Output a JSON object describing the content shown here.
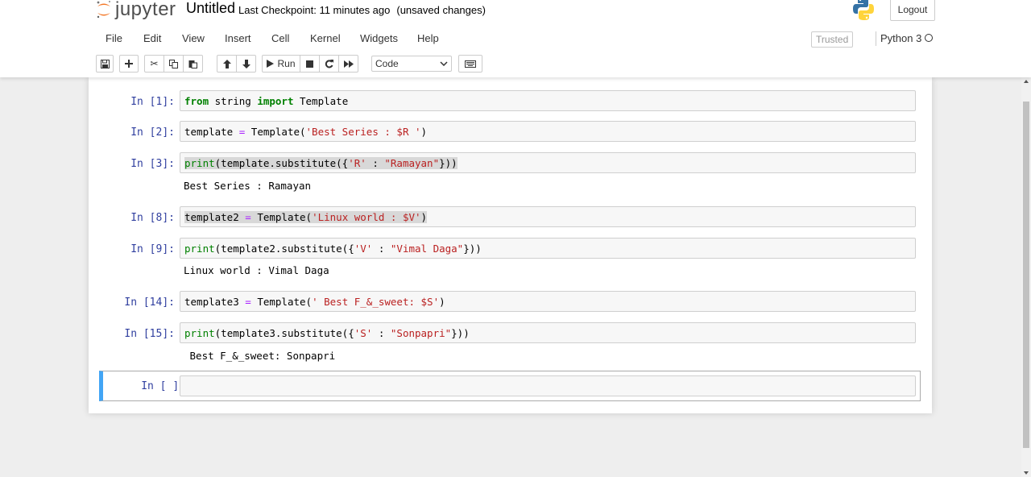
{
  "header": {
    "logo_text": "jupyter",
    "notebook_title": "Untitled",
    "checkpoint": "Last Checkpoint: 11 minutes ago",
    "unsaved": "(unsaved changes)",
    "logout_label": "Logout"
  },
  "menu": {
    "items": [
      "File",
      "Edit",
      "View",
      "Insert",
      "Cell",
      "Kernel",
      "Widgets",
      "Help"
    ],
    "trusted": "Trusted",
    "kernel_name": "Python 3"
  },
  "toolbar": {
    "run_label": "Run",
    "cell_type": "Code"
  },
  "cells": [
    {
      "prompt": "In [1]:",
      "output": ""
    },
    {
      "prompt": "In [2]:",
      "output": ""
    },
    {
      "prompt": "In [3]:",
      "output": "Best Series : Ramayan"
    },
    {
      "prompt": "In [8]:",
      "output": ""
    },
    {
      "prompt": "In [9]:",
      "output": "Linux world : Vimal Daga"
    },
    {
      "prompt": "In [14]:",
      "output": ""
    },
    {
      "prompt": "In [15]:",
      "output": " Best F_&_sweet: Sonpapri"
    },
    {
      "prompt": "In [ ]:",
      "output": ""
    }
  ],
  "code": {
    "c1": {
      "kw1": "from",
      "t1": " string ",
      "kw2": "import",
      "t2": " Template"
    },
    "c2": {
      "t1": "template ",
      "op": "=",
      "t2": " Template(",
      "s": "'Best Series : $R '",
      "t3": ")"
    },
    "c3": {
      "fn": "print",
      "t1": "(template.substitute({",
      "s1": "'R'",
      "t2": " : ",
      "s2": "\"Ramayan\"",
      "t3": "}))"
    },
    "c8": {
      "t1": "template2 ",
      "op": "=",
      "t2": " Template(",
      "s": "'Linux world : $V'",
      "t3": ")"
    },
    "c9": {
      "fn": "print",
      "t1": "(template2.substitute({",
      "s1": "'V'",
      "t2": " : ",
      "s2": "\"Vimal Daga\"",
      "t3": "}))"
    },
    "c14": {
      "t1": "template3 ",
      "op": "=",
      "t2": " Template(",
      "s": "' Best F_&_sweet: $S'",
      "t3": ")"
    },
    "c15": {
      "fn": "print",
      "t1": "(template3.substitute({",
      "s1": "'S'",
      "t2": " : ",
      "s2": "\"Sonpapri\"",
      "t3": "}))"
    }
  },
  "colors": {
    "accent": "#42a5f5",
    "prompt": "#303f9f",
    "keyword": "#008000",
    "string": "#ba2121",
    "operator": "#aa22ff"
  }
}
